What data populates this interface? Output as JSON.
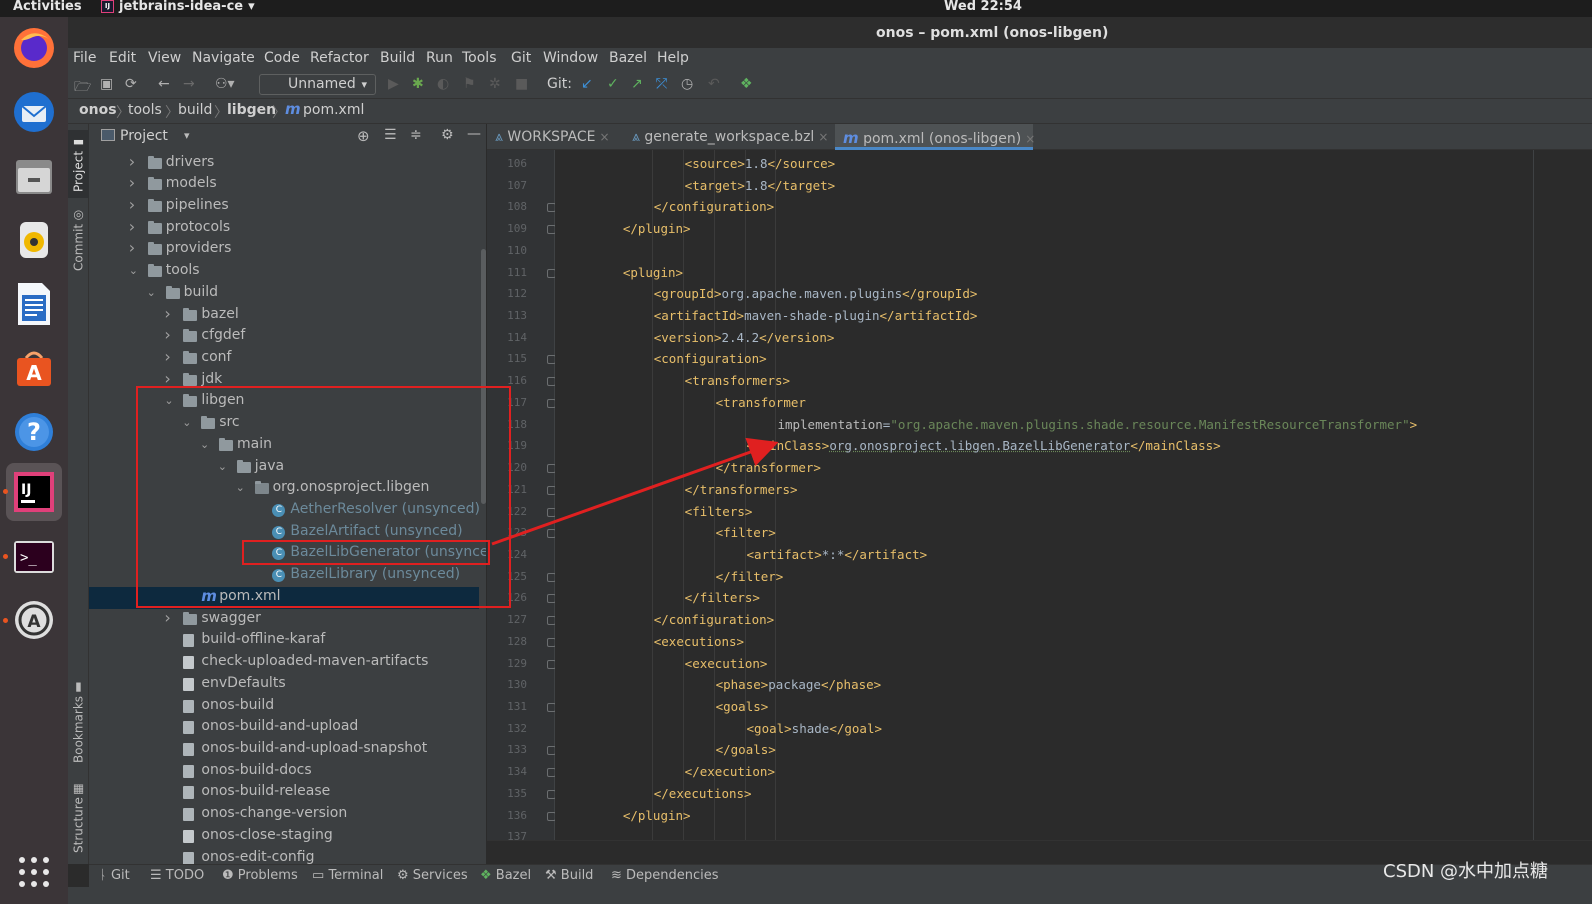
{
  "topbar": {
    "activities": "Activities",
    "app_name": "jetbrains-idea-ce",
    "app_chevron": "▾",
    "clock": "Wed 22:54"
  },
  "window": {
    "title": "onos – pom.xml (onos-libgen)"
  },
  "menu": [
    "File",
    "Edit",
    "View",
    "Navigate",
    "Code",
    "Refactor",
    "Build",
    "Run",
    "Tools",
    "Git",
    "Window",
    "Bazel",
    "Help"
  ],
  "toolbar": {
    "run_config": "Unnamed",
    "git_label": "Git:"
  },
  "breadcrumb": [
    "onos",
    "tools",
    "build",
    "libgen",
    "pom.xml"
  ],
  "side_tabs": {
    "project": "Project",
    "commit": "Commit",
    "bookmarks": "Bookmarks",
    "structure": "Structure"
  },
  "project_pane": {
    "title": "Project"
  },
  "tree": [
    {
      "label": "drivers",
      "type": "folder",
      "depth": 1,
      "open": false
    },
    {
      "label": "models",
      "type": "folder",
      "depth": 1,
      "open": false
    },
    {
      "label": "pipelines",
      "type": "folder",
      "depth": 1,
      "open": false
    },
    {
      "label": "protocols",
      "type": "folder",
      "depth": 1,
      "open": false
    },
    {
      "label": "providers",
      "type": "folder",
      "depth": 1,
      "open": false
    },
    {
      "label": "tools",
      "type": "folder",
      "depth": 1,
      "open": true
    },
    {
      "label": "build",
      "type": "folder",
      "depth": 2,
      "open": true
    },
    {
      "label": "bazel",
      "type": "folder",
      "depth": 3,
      "open": false
    },
    {
      "label": "cfgdef",
      "type": "folder",
      "depth": 3,
      "open": false
    },
    {
      "label": "conf",
      "type": "folder",
      "depth": 3,
      "open": false
    },
    {
      "label": "jdk",
      "type": "folder",
      "depth": 3,
      "open": false
    },
    {
      "label": "libgen",
      "type": "folder",
      "depth": 3,
      "open": true
    },
    {
      "label": "src",
      "type": "folder",
      "depth": 4,
      "open": true
    },
    {
      "label": "main",
      "type": "folder",
      "depth": 5,
      "open": true
    },
    {
      "label": "java",
      "type": "folder",
      "depth": 6,
      "open": true
    },
    {
      "label": "org.onosproject.libgen",
      "type": "package",
      "depth": 7,
      "open": true
    },
    {
      "label": "AetherResolver (unsynced)",
      "type": "class",
      "depth": 8
    },
    {
      "label": "BazelArtifact (unsynced)",
      "type": "class",
      "depth": 8
    },
    {
      "label": "BazelLibGenerator (unsynced)",
      "type": "class",
      "depth": 8
    },
    {
      "label": "BazelLibrary (unsynced)",
      "type": "class",
      "depth": 8
    },
    {
      "label": "pom.xml",
      "type": "maven",
      "depth": 4,
      "selected": true
    },
    {
      "label": "swagger",
      "type": "folder",
      "depth": 3,
      "open": false
    },
    {
      "label": "build-offline-karaf",
      "type": "script",
      "depth": 3
    },
    {
      "label": "check-uploaded-maven-artifacts",
      "type": "file",
      "depth": 3
    },
    {
      "label": "envDefaults",
      "type": "file",
      "depth": 3
    },
    {
      "label": "onos-build",
      "type": "script",
      "depth": 3
    },
    {
      "label": "onos-build-and-upload",
      "type": "script",
      "depth": 3
    },
    {
      "label": "onos-build-and-upload-snapshot",
      "type": "script",
      "depth": 3
    },
    {
      "label": "onos-build-docs",
      "type": "script",
      "depth": 3
    },
    {
      "label": "onos-build-release",
      "type": "script",
      "depth": 3
    },
    {
      "label": "onos-change-version",
      "type": "script",
      "depth": 3
    },
    {
      "label": "onos-close-staging",
      "type": "file",
      "depth": 3
    },
    {
      "label": "onos-edit-config",
      "type": "script",
      "depth": 3
    }
  ],
  "editor_tabs": [
    {
      "label": "WORKSPACE",
      "close": "×"
    },
    {
      "label": "generate_workspace.bzl",
      "close": "×"
    },
    {
      "label": "pom.xml (onos-libgen)",
      "close": "×",
      "active": true
    }
  ],
  "code_lines": [
    {
      "n": "106",
      "indent": 5,
      "parts": [
        [
          "tg",
          "<source>"
        ],
        [
          "tx",
          "1.8"
        ],
        [
          "tg",
          "</source>"
        ]
      ]
    },
    {
      "n": "107",
      "indent": 5,
      "parts": [
        [
          "tg",
          "<target>"
        ],
        [
          "tx",
          "1.8"
        ],
        [
          "tg",
          "</target>"
        ]
      ]
    },
    {
      "n": "108",
      "indent": 4,
      "parts": [
        [
          "tg",
          "</configuration>"
        ]
      ]
    },
    {
      "n": "109",
      "indent": 3,
      "parts": [
        [
          "tg",
          "</plugin>"
        ]
      ]
    },
    {
      "n": "110",
      "indent": 0,
      "parts": []
    },
    {
      "n": "111",
      "indent": 3,
      "parts": [
        [
          "tg",
          "<plugin>"
        ]
      ]
    },
    {
      "n": "112",
      "indent": 4,
      "parts": [
        [
          "tg",
          "<groupId>"
        ],
        [
          "tx",
          "org.apache.maven.plugins"
        ],
        [
          "tg",
          "</groupId>"
        ]
      ]
    },
    {
      "n": "113",
      "indent": 4,
      "parts": [
        [
          "tg",
          "<artifactId>"
        ],
        [
          "tx",
          "maven-shade-plugin"
        ],
        [
          "tg",
          "</artifactId>"
        ]
      ]
    },
    {
      "n": "114",
      "indent": 4,
      "parts": [
        [
          "tg",
          "<version>"
        ],
        [
          "tx",
          "2.4.2"
        ],
        [
          "tg",
          "</version>"
        ]
      ]
    },
    {
      "n": "115",
      "indent": 4,
      "parts": [
        [
          "tg",
          "<configuration>"
        ]
      ]
    },
    {
      "n": "116",
      "indent": 5,
      "parts": [
        [
          "tg",
          "<transformers>"
        ]
      ]
    },
    {
      "n": "117",
      "indent": 6,
      "parts": [
        [
          "tg",
          "<transformer"
        ]
      ]
    },
    {
      "n": "118",
      "indent": 8,
      "parts": [
        [
          "at",
          "implementation"
        ],
        [
          "tx",
          "="
        ],
        [
          "av",
          "\"org.apache.maven.plugins.shade.resource.ManifestResourceTransformer\""
        ],
        [
          "tg",
          ">"
        ]
      ]
    },
    {
      "n": "119",
      "indent": 7,
      "parts": [
        [
          "tg",
          "<mainClass>"
        ],
        [
          "tx",
          "org.onosproject.libgen.BazelLibGenerator"
        ],
        [
          "tg",
          "</mainClass>"
        ]
      ]
    },
    {
      "n": "120",
      "indent": 6,
      "parts": [
        [
          "tg",
          "</transformer>"
        ]
      ]
    },
    {
      "n": "121",
      "indent": 5,
      "parts": [
        [
          "tg",
          "</transformers>"
        ]
      ]
    },
    {
      "n": "122",
      "indent": 5,
      "parts": [
        [
          "tg",
          "<filters>"
        ]
      ]
    },
    {
      "n": "123",
      "indent": 6,
      "parts": [
        [
          "tg",
          "<filter>"
        ]
      ]
    },
    {
      "n": "124",
      "indent": 7,
      "parts": [
        [
          "tg",
          "<artifact>"
        ],
        [
          "tx",
          "*:*"
        ],
        [
          "tg",
          "</artifact>"
        ]
      ]
    },
    {
      "n": "125",
      "indent": 6,
      "parts": [
        [
          "tg",
          "</filter>"
        ]
      ]
    },
    {
      "n": "126",
      "indent": 5,
      "parts": [
        [
          "tg",
          "</filters>"
        ]
      ]
    },
    {
      "n": "127",
      "indent": 4,
      "parts": [
        [
          "tg",
          "</configuration>"
        ]
      ]
    },
    {
      "n": "128",
      "indent": 4,
      "parts": [
        [
          "tg",
          "<executions>"
        ]
      ]
    },
    {
      "n": "129",
      "indent": 5,
      "parts": [
        [
          "tg",
          "<execution>"
        ]
      ]
    },
    {
      "n": "130",
      "indent": 6,
      "parts": [
        [
          "tg",
          "<phase>"
        ],
        [
          "tx",
          "package"
        ],
        [
          "tg",
          "</phase>"
        ]
      ]
    },
    {
      "n": "131",
      "indent": 6,
      "parts": [
        [
          "tg",
          "<goals>"
        ]
      ]
    },
    {
      "n": "132",
      "indent": 7,
      "parts": [
        [
          "tg",
          "<goal>"
        ],
        [
          "tx",
          "shade"
        ],
        [
          "tg",
          "</goal>"
        ]
      ]
    },
    {
      "n": "133",
      "indent": 6,
      "parts": [
        [
          "tg",
          "</goals>"
        ]
      ]
    },
    {
      "n": "134",
      "indent": 5,
      "parts": [
        [
          "tg",
          "</execution>"
        ]
      ]
    },
    {
      "n": "135",
      "indent": 4,
      "parts": [
        [
          "tg",
          "</executions>"
        ]
      ]
    },
    {
      "n": "136",
      "indent": 3,
      "parts": [
        [
          "tg",
          "</plugin>"
        ]
      ]
    },
    {
      "n": "137",
      "indent": 0,
      "parts": []
    }
  ],
  "bottom_tools": [
    "Git",
    "TODO",
    "Problems",
    "Terminal",
    "Services",
    "Bazel",
    "Build",
    "Dependencies"
  ],
  "watermark": "CSDN @水中加点糖",
  "colors": {
    "accent_red": "#e02020",
    "tag": "#e8bf6a",
    "attr_value": "#6a8759",
    "selection": "#0d293e"
  }
}
